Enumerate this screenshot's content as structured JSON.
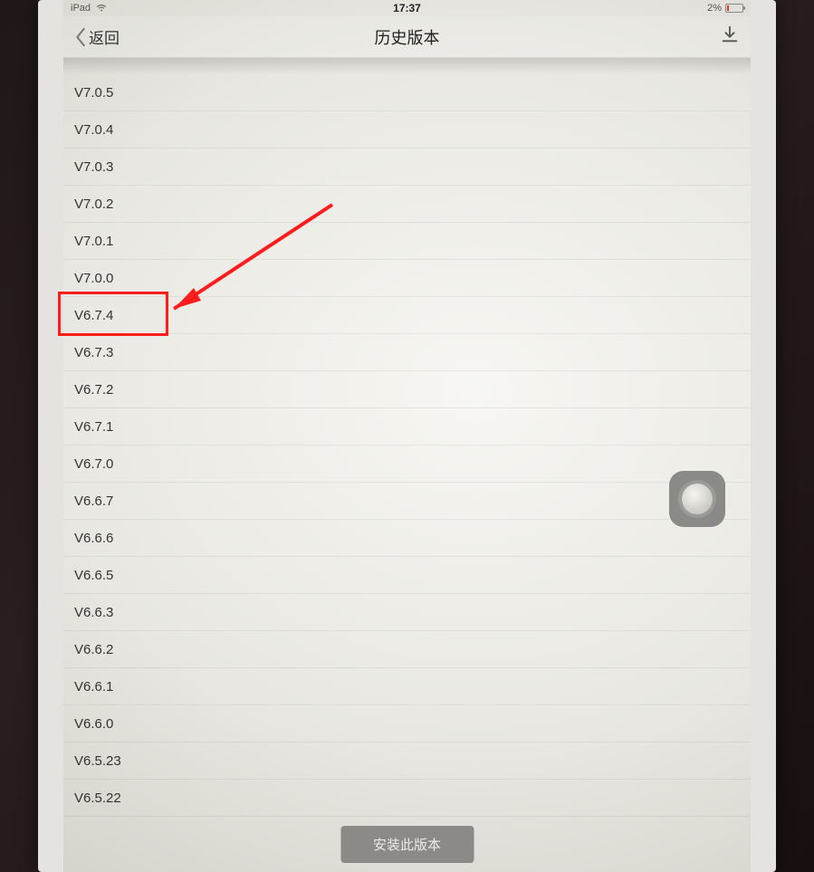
{
  "status_bar": {
    "device_label": "iPad",
    "time": "17:37",
    "battery_percent": "2%"
  },
  "navbar": {
    "back_label": "返回",
    "title": "历史版本"
  },
  "versions": [
    "V7.0.5",
    "V7.0.4",
    "V7.0.3",
    "V7.0.2",
    "V7.0.1",
    "V7.0.0",
    "V6.7.4",
    "V6.7.3",
    "V6.7.2",
    "V6.7.1",
    "V6.7.0",
    "V6.6.7",
    "V6.6.6",
    "V6.6.5",
    "V6.6.3",
    "V6.6.2",
    "V6.6.1",
    "V6.6.0",
    "V6.5.23",
    "V6.5.22"
  ],
  "install_button_label": "安装此版本",
  "highlighted_version_index": 6,
  "annotation": {
    "highlight_color": "#ff1c1c"
  }
}
